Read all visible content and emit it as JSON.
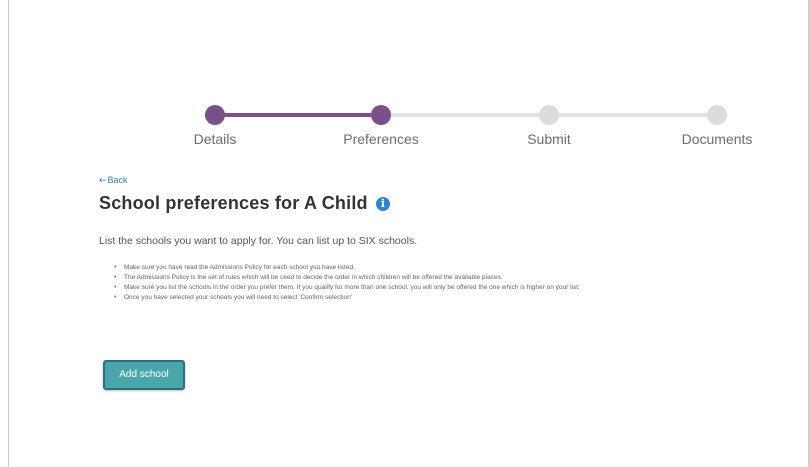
{
  "stepper": {
    "steps": [
      {
        "label": "Details",
        "state": "complete"
      },
      {
        "label": "Preferences",
        "state": "current"
      },
      {
        "label": "Submit",
        "state": "pending"
      },
      {
        "label": "Documents",
        "state": "pending"
      }
    ]
  },
  "back_link": {
    "icon": "left-arrow-icon",
    "label": "Back"
  },
  "page": {
    "title": "School preferences for A Child",
    "info_icon": "info-icon",
    "intro": "List the schools you want to apply for. You can list up to SIX schools.",
    "bullets": [
      "Make sure you have read the Admissions Policy for each school you have listed.",
      "The Admissions Policy is the set of rules which will be used to decide the order in which children will be offered the available places.",
      "Make sure you list the schools in the order you prefer them. If you qualify for more than one school, you will only be offered the one which is higher on your list.",
      "Once you have selected your schools you will need to select 'Confirm selection'"
    ]
  },
  "actions": {
    "add_school_label": "Add school"
  },
  "colors": {
    "progress_complete": "#7b4f8a",
    "progress_pending": "#dcdcdc",
    "link": "#2f7fc4",
    "button": "#4aa6ad",
    "info": "#2f86cf"
  }
}
